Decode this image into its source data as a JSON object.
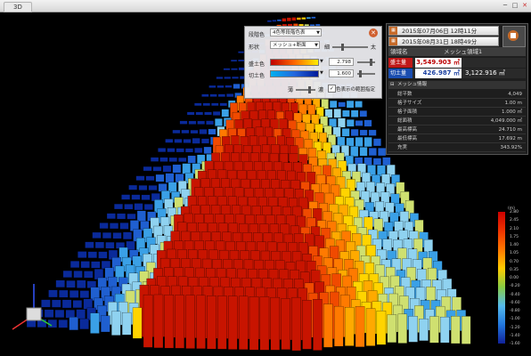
{
  "window": {
    "tab_label": "3D"
  },
  "controls": {
    "rows": [
      {
        "label": "段階色",
        "dropdown": "4色等段階色表"
      },
      {
        "label": "形状",
        "dropdown": "メッシュ+断面"
      }
    ],
    "slider_low": "細",
    "slider_high": "太",
    "fill": {
      "label": "盛土色",
      "value": "2.798"
    },
    "cut": {
      "label": "切土色",
      "value": "1.600"
    },
    "thin_label": "薄",
    "thick_label": "濃",
    "checkbox_label": "色表示の範囲指定"
  },
  "info": {
    "date1": "2015年07月06日 12時11分",
    "date2": "2015年08月31日 18時49分",
    "area_label": "領域名",
    "area_name": "メッシュ領域1",
    "fill_label": "盛土量",
    "fill_value": "3,549.903 ㎥",
    "cut_label": "切土量",
    "cut_value": "426.987 ㎥",
    "net_value": "3,122.916 ㎥",
    "mesh_header": "メッシュ情報",
    "mesh_rows": [
      {
        "key": "総平数",
        "value": "4,049"
      },
      {
        "key": "格子サイズ",
        "value": "1.00 m"
      },
      {
        "key": "格子面積",
        "value": "1.000 ㎡"
      },
      {
        "key": "総面積",
        "value": "4,049.000 ㎡"
      },
      {
        "key": "最高標高",
        "value": "24.710 m"
      },
      {
        "key": "最低標高",
        "value": "17.692 m"
      },
      {
        "key": "充実",
        "value": "343.92%"
      }
    ]
  },
  "legend": {
    "unit": "(m)",
    "ticks": [
      "2.80",
      "2.45",
      "2.10",
      "1.75",
      "1.40",
      "1.05",
      "0.70",
      "0.35",
      "0.00",
      "-0.20",
      "-0.40",
      "-0.60",
      "-0.80",
      "-1.00",
      "-1.20",
      "-1.40",
      "-1.60"
    ],
    "colors": [
      "#cc0000",
      "#ee3300",
      "#ff7700",
      "#ffcc00",
      "#88cc44",
      "#55bbee",
      "#2277dd",
      "#112299"
    ]
  }
}
